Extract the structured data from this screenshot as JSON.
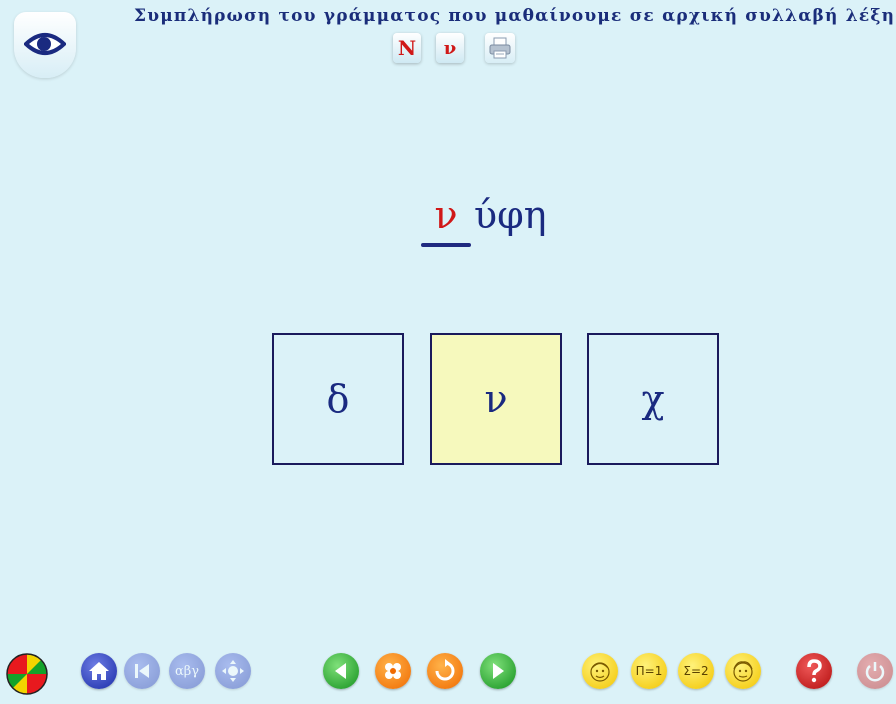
{
  "header": {
    "title": "Συμπλήρωση του γράμματος που μαθαίνουμε σε αρχική συλλαβή λέξης",
    "uppercase_letter": "Ν",
    "lowercase_letter": "ν",
    "print_icon": "printer-icon",
    "logo_icon": "eye-icon"
  },
  "exercise": {
    "filled_letter": "ν",
    "word_remainder": "ύφη",
    "choices": [
      "δ",
      "ν",
      "χ"
    ],
    "selected_choice": "ν"
  },
  "toolbar": {
    "left": [
      "color-wheel-icon",
      "home-icon",
      "first-icon",
      "alphabet-icon",
      "navigate-icon"
    ],
    "alphabet_label": "αβγ",
    "center": [
      "previous-icon",
      "cookie-icon",
      "refresh-icon",
      "next-icon"
    ],
    "right": [
      "hint-face-icon",
      "p1-icon",
      "s2-icon",
      "help-face-icon",
      "question-icon",
      "power-icon"
    ],
    "p1_label": "Π=1",
    "s2_label": "Σ=2"
  },
  "colors": {
    "background": "#dbf2f8",
    "title": "#1a2d7a",
    "accent_red": "#d01818",
    "selected_choice": "#f6f9bd"
  }
}
